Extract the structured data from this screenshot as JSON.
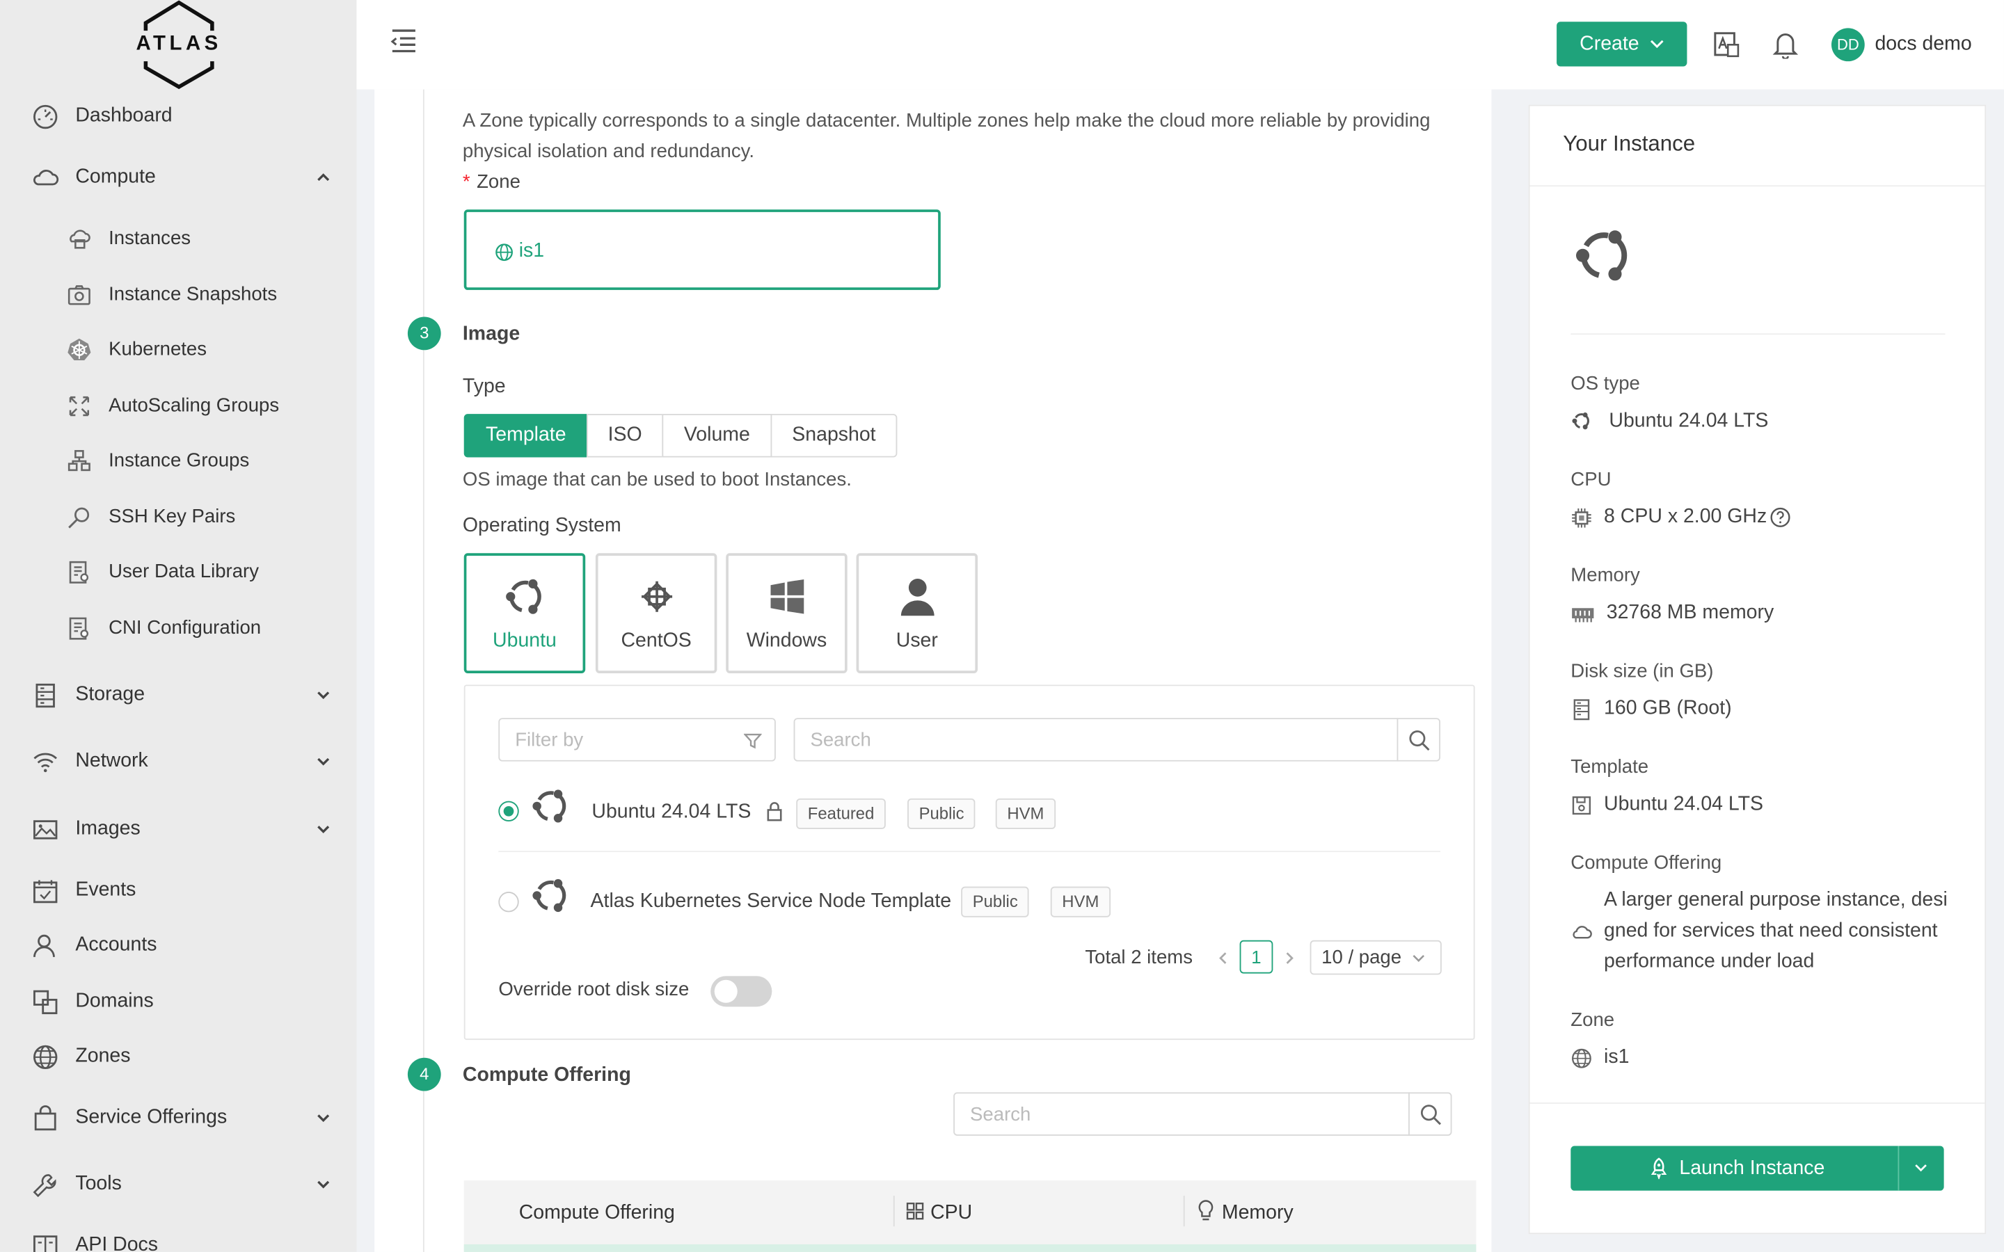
{
  "app": {
    "logo_text": "ATLAS"
  },
  "sidebar": {
    "items": [
      {
        "label": "Dashboard",
        "icon": "dashboard-icon"
      },
      {
        "label": "Compute",
        "icon": "cloud-icon"
      },
      {
        "label": "Storage",
        "icon": "storage-icon"
      },
      {
        "label": "Network",
        "icon": "wifi-icon"
      },
      {
        "label": "Images",
        "icon": "picture-icon"
      },
      {
        "label": "Events",
        "icon": "calendar-icon"
      },
      {
        "label": "Accounts",
        "icon": "user-icon"
      },
      {
        "label": "Domains",
        "icon": "block-icon"
      },
      {
        "label": "Zones",
        "icon": "globe-icon"
      },
      {
        "label": "Service Offerings",
        "icon": "shopping-icon"
      },
      {
        "label": "Tools",
        "icon": "tool-icon"
      },
      {
        "label": "API Docs",
        "icon": "book-icon"
      }
    ],
    "compute_sub": [
      {
        "label": "Instances",
        "icon": "instances-icon"
      },
      {
        "label": "Instance Snapshots",
        "icon": "camera-icon"
      },
      {
        "label": "Kubernetes",
        "icon": "kubernetes-icon"
      },
      {
        "label": "AutoScaling Groups",
        "icon": "expand-icon"
      },
      {
        "label": "Instance Groups",
        "icon": "cluster-icon"
      },
      {
        "label": "SSH Key Pairs",
        "icon": "key-icon"
      },
      {
        "label": "User Data Library",
        "icon": "solution-icon"
      },
      {
        "label": "CNI Configuration",
        "icon": "solution-icon"
      }
    ]
  },
  "header": {
    "create_label": "Create",
    "user_initials": "DD",
    "user_name": "docs demo"
  },
  "zone": {
    "description_line1": "A Zone typically corresponds to a single datacenter. Multiple zones help make the cloud more reliable by providing",
    "description_line2": "physical isolation and redundancy.",
    "required_mark": "*",
    "label": "Zone",
    "selected": "is1"
  },
  "image": {
    "step": "3",
    "title": "Image",
    "type_label": "Type",
    "types": [
      "Template",
      "ISO",
      "Volume",
      "Snapshot"
    ],
    "type_help": "OS image that can be used to boot Instances.",
    "os_label": "Operating System",
    "os_options": [
      "Ubuntu",
      "CentOS",
      "Windows",
      "User"
    ],
    "filter_placeholder": "Filter by",
    "search_placeholder": "Search",
    "templates": [
      {
        "name": "Ubuntu 24.04 LTS",
        "tags": [
          "Featured",
          "Public",
          "HVM"
        ],
        "selected": true
      },
      {
        "name": "Atlas Kubernetes Service Node Template",
        "tags": [
          "Public",
          "HVM"
        ],
        "selected": false
      }
    ],
    "total": "Total 2 items",
    "current_page": "1",
    "page_size": "10 / page",
    "override_label": "Override root disk size"
  },
  "compute": {
    "step": "4",
    "title": "Compute Offering",
    "search_placeholder": "Search",
    "col_offering": "Compute Offering",
    "col_cpu": "CPU",
    "col_memory": "Memory"
  },
  "summary": {
    "title": "Your Instance",
    "os_type_label": "OS type",
    "os_type": "Ubuntu 24.04 LTS",
    "cpu_label": "CPU",
    "cpu": "8 CPU x 2.00 GHz",
    "memory_label": "Memory",
    "memory": "32768 MB memory",
    "disk_label": "Disk size (in GB)",
    "disk": "160 GB (Root)",
    "template_label": "Template",
    "template": "Ubuntu 24.04 LTS",
    "offering_label": "Compute Offering",
    "offering_line1": "A larger general purpose instance, desi",
    "offering_line2": "gned for services that need consistent",
    "offering_line3": "performance under load",
    "zone_label": "Zone",
    "zone": "is1",
    "launch_label": "Launch Instance"
  },
  "colors": {
    "accent": "#1fa37b"
  }
}
